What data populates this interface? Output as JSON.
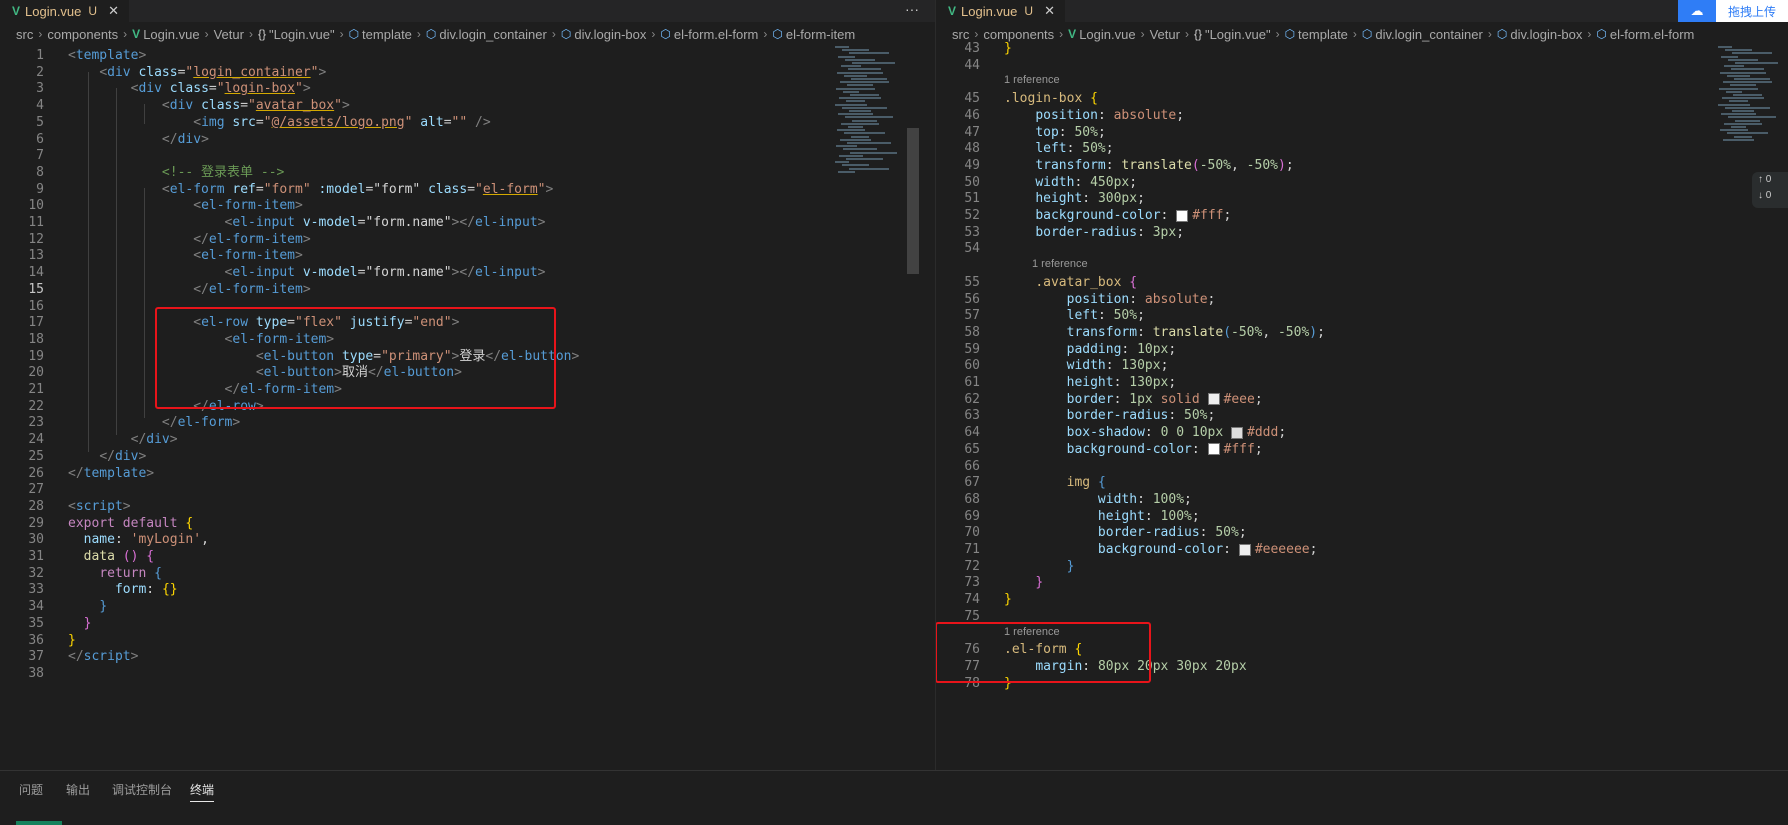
{
  "left": {
    "tab": {
      "logo": "V",
      "filename": "Login.vue",
      "status": "U",
      "close": "✕"
    },
    "more": "···",
    "breadcrumbs": [
      "src",
      "components",
      "Login.vue",
      "Vetur",
      "\"Login.vue\"",
      "template",
      "div.login_container",
      "div.login-box",
      "el-form.el-form",
      "el-form-item"
    ],
    "lines": [
      {
        "n": "1",
        "h": "<span class=\"tg\">&lt;</span><span class=\"tn\">template</span><span class=\"tg\">&gt;</span>"
      },
      {
        "n": "2",
        "h": "    <span class=\"tg\">&lt;</span><span class=\"tn\">div</span> <span class=\"at\">class</span>=<span class=\"st\">\"<span class=\"ul\">login_container</span>\"</span><span class=\"tg\">&gt;</span>"
      },
      {
        "n": "3",
        "h": "        <span class=\"tg\">&lt;</span><span class=\"tn\">div</span> <span class=\"at\">class</span>=<span class=\"st\">\"<span class=\"ul\">login-box</span>\"</span><span class=\"tg\">&gt;</span>"
      },
      {
        "n": "4",
        "h": "            <span class=\"tg\">&lt;</span><span class=\"tn\">div</span> <span class=\"at\">class</span>=<span class=\"st\">\"<span class=\"ul\">avatar_box</span>\"</span><span class=\"tg\">&gt;</span>"
      },
      {
        "n": "5",
        "h": "                <span class=\"tg\">&lt;</span><span class=\"tn\">img</span> <span class=\"at\">src</span>=<span class=\"st\">\"<span class=\"ul\">@/assets/logo.png</span>\"</span> <span class=\"at\">alt</span>=<span class=\"st\">\"\"</span> <span class=\"tg\">/&gt;</span>"
      },
      {
        "n": "6",
        "h": "            <span class=\"tg\">&lt;/</span><span class=\"tn\">div</span><span class=\"tg\">&gt;</span>"
      },
      {
        "n": "7",
        "h": ""
      },
      {
        "n": "8",
        "h": "            <span class=\"cm\">&lt;!-- 登录表单 --&gt;</span>"
      },
      {
        "n": "9",
        "h": "            <span class=\"tg\">&lt;</span><span class=\"tn\">el-form</span> <span class=\"at\">ref</span>=<span class=\"st\">\"form\"</span> <span class=\"at\">:model</span>=<span class=\"tx\">\"form\"</span> <span class=\"at\">class</span>=<span class=\"st\">\"<span class=\"ul\">el-form</span>\"</span><span class=\"tg\">&gt;</span>"
      },
      {
        "n": "10",
        "h": "                <span class=\"tg\">&lt;</span><span class=\"tn\">el-form-item</span><span class=\"tg\">&gt;</span>"
      },
      {
        "n": "11",
        "h": "                    <span class=\"tg\">&lt;</span><span class=\"tn\">el-input</span> <span class=\"at\">v-model</span>=<span class=\"tx\">\"form.name\"</span><span class=\"tg\">&gt;&lt;/</span><span class=\"tn\">el-input</span><span class=\"tg\">&gt;</span>"
      },
      {
        "n": "12",
        "h": "                <span class=\"tg\">&lt;/</span><span class=\"tn\">el-form-item</span><span class=\"tg\">&gt;</span>"
      },
      {
        "n": "13",
        "h": "                <span class=\"tg\">&lt;</span><span class=\"tn\">el-form-item</span><span class=\"tg\">&gt;</span>"
      },
      {
        "n": "14",
        "h": "                    <span class=\"tg\">&lt;</span><span class=\"tn\">el-input</span> <span class=\"at\">v-model</span>=<span class=\"tx\">\"form.name\"</span><span class=\"tg\">&gt;&lt;/</span><span class=\"tn\">el-input</span><span class=\"tg\">&gt;</span>"
      },
      {
        "n": "15",
        "h": "                <span class=\"tg\">&lt;/</span><span class=\"tn\">el-form-item</span><span class=\"tg\">&gt;</span>",
        "active": true
      },
      {
        "n": "16",
        "h": ""
      },
      {
        "n": "17",
        "h": "                <span class=\"tg\">&lt;</span><span class=\"tn\">el-row</span> <span class=\"at\">type</span>=<span class=\"st\">\"flex\"</span> <span class=\"at\">justify</span>=<span class=\"st\">\"end\"</span><span class=\"tg\">&gt;</span>"
      },
      {
        "n": "18",
        "h": "                    <span class=\"tg\">&lt;</span><span class=\"tn\">el-form-item</span><span class=\"tg\">&gt;</span>"
      },
      {
        "n": "19",
        "h": "                        <span class=\"tg\">&lt;</span><span class=\"tn\">el-button</span> <span class=\"at\">type</span>=<span class=\"st\">\"primary\"</span><span class=\"tg\">&gt;</span><span class=\"tx\">登录</span><span class=\"tg\">&lt;/</span><span class=\"tn\">el-button</span><span class=\"tg\">&gt;</span>"
      },
      {
        "n": "20",
        "h": "                        <span class=\"tg\">&lt;</span><span class=\"tn\">el-button</span><span class=\"tg\">&gt;</span><span class=\"tx\">取消</span><span class=\"tg\">&lt;/</span><span class=\"tn\">el-button</span><span class=\"tg\">&gt;</span>"
      },
      {
        "n": "21",
        "h": "                    <span class=\"tg\">&lt;/</span><span class=\"tn\">el-form-item</span><span class=\"tg\">&gt;</span>"
      },
      {
        "n": "22",
        "h": "                <span class=\"tg\">&lt;/</span><span class=\"tn\">el-row</span><span class=\"tg\">&gt;</span>"
      },
      {
        "n": "23",
        "h": "            <span class=\"tg\">&lt;/</span><span class=\"tn\">el-form</span><span class=\"tg\">&gt;</span>"
      },
      {
        "n": "24",
        "h": "        <span class=\"tg\">&lt;/</span><span class=\"tn\">div</span><span class=\"tg\">&gt;</span>"
      },
      {
        "n": "25",
        "h": "    <span class=\"tg\">&lt;/</span><span class=\"tn\">div</span><span class=\"tg\">&gt;</span>"
      },
      {
        "n": "26",
        "h": "<span class=\"tg\">&lt;/</span><span class=\"tn\">template</span><span class=\"tg\">&gt;</span>"
      },
      {
        "n": "27",
        "h": ""
      },
      {
        "n": "28",
        "h": "<span class=\"tg\">&lt;</span><span class=\"tn\">script</span><span class=\"tg\">&gt;</span>"
      },
      {
        "n": "29",
        "h": "<span class=\"kw\">export</span> <span class=\"kw\">default</span> <span class=\"bk\">{</span>"
      },
      {
        "n": "30",
        "h": "  <span class=\"pr\">name</span><span class=\"tx\">:</span> <span class=\"st\">'myLogin'</span><span class=\"tx\">,</span>"
      },
      {
        "n": "31",
        "h": "  <span class=\"fn\">data</span> <span class=\"bk2\">()</span> <span class=\"bk2\">{</span>"
      },
      {
        "n": "32",
        "h": "    <span class=\"kw\">return</span> <span class=\"kd\">{</span>"
      },
      {
        "n": "33",
        "h": "      <span class=\"pr\">form</span><span class=\"tx\">:</span> <span class=\"bk\">{}</span>"
      },
      {
        "n": "34",
        "h": "    <span class=\"kd\">}</span>"
      },
      {
        "n": "35",
        "h": "  <span class=\"bk2\">}</span>"
      },
      {
        "n": "36",
        "h": "<span class=\"bk\">}</span>"
      },
      {
        "n": "37",
        "h": "<span class=\"tg\">&lt;/</span><span class=\"tn\">script</span><span class=\"tg\">&gt;</span>"
      },
      {
        "n": "38",
        "h": ""
      }
    ]
  },
  "right": {
    "tab": {
      "logo": "V",
      "filename": "Login.vue",
      "status": "U",
      "close": "✕"
    },
    "breadcrumbs": [
      "src",
      "components",
      "Login.vue",
      "Vetur",
      "\"Login.vue\"",
      "template",
      "div.login_container",
      "div.login-box",
      "el-form.el-form"
    ],
    "upload_label": "拖拽上传",
    "side_widget": [
      "↑ 0",
      "↓ 0"
    ],
    "lines": [
      {
        "n": "43",
        "h": "<span class=\"bk\">}</span>"
      },
      {
        "n": "44",
        "h": ""
      },
      {
        "lens": "1 reference"
      },
      {
        "n": "45",
        "h": "<span class=\"sel\">.login-box</span> <span class=\"bk\">{</span>"
      },
      {
        "n": "46",
        "h": "    <span class=\"pr\">position</span><span class=\"tx\">:</span> <span class=\"vl\">absolute</span><span class=\"tx\">;</span>"
      },
      {
        "n": "47",
        "h": "    <span class=\"pr\">top</span><span class=\"tx\">:</span> <span class=\"nm\">50%</span><span class=\"tx\">;</span>"
      },
      {
        "n": "48",
        "h": "    <span class=\"pr\">left</span><span class=\"tx\">:</span> <span class=\"nm\">50%</span><span class=\"tx\">;</span>"
      },
      {
        "n": "49",
        "h": "    <span class=\"pr\">transform</span><span class=\"tx\">:</span> <span class=\"fn\">translate</span><span class=\"bk2\">(</span><span class=\"nm\">-50%</span><span class=\"tx\">,</span> <span class=\"nm\">-50%</span><span class=\"bk2\">)</span><span class=\"tx\">;</span>"
      },
      {
        "n": "50",
        "h": "    <span class=\"pr\">width</span><span class=\"tx\">:</span> <span class=\"nm\">450px</span><span class=\"tx\">;</span>"
      },
      {
        "n": "51",
        "h": "    <span class=\"pr\">height</span><span class=\"tx\">:</span> <span class=\"nm\">300px</span><span class=\"tx\">;</span>"
      },
      {
        "n": "52",
        "h": "    <span class=\"pr\">background-color</span><span class=\"tx\">:</span> <span class=\"sw\" style=\"background:#fff\"></span><span class=\"vl\">#fff</span><span class=\"tx\">;</span>"
      },
      {
        "n": "53",
        "h": "    <span class=\"pr\">border-radius</span><span class=\"tx\">:</span> <span class=\"nm\">3px</span><span class=\"tx\">;</span>"
      },
      {
        "n": "54",
        "h": ""
      },
      {
        "lens": "1 reference",
        "indent": true
      },
      {
        "n": "55",
        "h": "    <span class=\"sel\">.avatar_box</span> <span class=\"bk2\">{</span>"
      },
      {
        "n": "56",
        "h": "        <span class=\"pr\">position</span><span class=\"tx\">:</span> <span class=\"vl\">absolute</span><span class=\"tx\">;</span>"
      },
      {
        "n": "57",
        "h": "        <span class=\"pr\">left</span><span class=\"tx\">:</span> <span class=\"nm\">50%</span><span class=\"tx\">;</span>"
      },
      {
        "n": "58",
        "h": "        <span class=\"pr\">transform</span><span class=\"tx\">:</span> <span class=\"fn\">translate</span><span class=\"kd\">(</span><span class=\"nm\">-50%</span><span class=\"tx\">,</span> <span class=\"nm\">-50%</span><span class=\"kd\">)</span><span class=\"tx\">;</span>"
      },
      {
        "n": "59",
        "h": "        <span class=\"pr\">padding</span><span class=\"tx\">:</span> <span class=\"nm\">10px</span><span class=\"tx\">;</span>"
      },
      {
        "n": "60",
        "h": "        <span class=\"pr\">width</span><span class=\"tx\">:</span> <span class=\"nm\">130px</span><span class=\"tx\">;</span>"
      },
      {
        "n": "61",
        "h": "        <span class=\"pr\">height</span><span class=\"tx\">:</span> <span class=\"nm\">130px</span><span class=\"tx\">;</span>"
      },
      {
        "n": "62",
        "h": "        <span class=\"pr\">border</span><span class=\"tx\">:</span> <span class=\"nm\">1px</span> <span class=\"vl\">solid</span> <span class=\"sw\" style=\"background:#eee\"></span><span class=\"vl\">#eee</span><span class=\"tx\">;</span>"
      },
      {
        "n": "63",
        "h": "        <span class=\"pr\">border-radius</span><span class=\"tx\">:</span> <span class=\"nm\">50%</span><span class=\"tx\">;</span>"
      },
      {
        "n": "64",
        "h": "        <span class=\"pr\">box-shadow</span><span class=\"tx\">:</span> <span class=\"nm\">0</span> <span class=\"nm\">0</span> <span class=\"nm\">10px</span> <span class=\"sw\" style=\"background:#ddd\"></span><span class=\"vl\">#ddd</span><span class=\"tx\">;</span>"
      },
      {
        "n": "65",
        "h": "        <span class=\"pr\">background-color</span><span class=\"tx\">:</span> <span class=\"sw\" style=\"background:#fff\"></span><span class=\"vl\">#fff</span><span class=\"tx\">;</span>"
      },
      {
        "n": "66",
        "h": ""
      },
      {
        "n": "67",
        "h": "        <span class=\"sel\">img</span> <span class=\"kd\">{</span>"
      },
      {
        "n": "68",
        "h": "            <span class=\"pr\">width</span><span class=\"tx\">:</span> <span class=\"nm\">100%</span><span class=\"tx\">;</span>"
      },
      {
        "n": "69",
        "h": "            <span class=\"pr\">height</span><span class=\"tx\">:</span> <span class=\"nm\">100%</span><span class=\"tx\">;</span>"
      },
      {
        "n": "70",
        "h": "            <span class=\"pr\">border-radius</span><span class=\"tx\">:</span> <span class=\"nm\">50%</span><span class=\"tx\">;</span>"
      },
      {
        "n": "71",
        "h": "            <span class=\"pr\">background-color</span><span class=\"tx\">:</span> <span class=\"sw\" style=\"background:#eeeeee\"></span><span class=\"vl\">#eeeeee</span><span class=\"tx\">;</span>"
      },
      {
        "n": "72",
        "h": "        <span class=\"kd\">}</span>"
      },
      {
        "n": "73",
        "h": "    <span class=\"bk2\">}</span>"
      },
      {
        "n": "74",
        "h": "<span class=\"bk\">}</span>"
      },
      {
        "n": "75",
        "h": ""
      },
      {
        "lens": "1 reference"
      },
      {
        "n": "76",
        "h": "<span class=\"sel\">.el-form</span> <span class=\"bk\">{</span>"
      },
      {
        "n": "77",
        "h": "    <span class=\"pr\">margin</span><span class=\"tx\">:</span> <span class=\"nm\">80px</span> <span class=\"nm\">20px</span> <span class=\"nm\">30px</span> <span class=\"nm\">20px</span>"
      },
      {
        "n": "78",
        "h": "<span class=\"bk\">}</span>"
      }
    ]
  },
  "panel": {
    "tabs": [
      "问题",
      "输出",
      "调试控制台",
      "终端"
    ],
    "active": "终端"
  }
}
